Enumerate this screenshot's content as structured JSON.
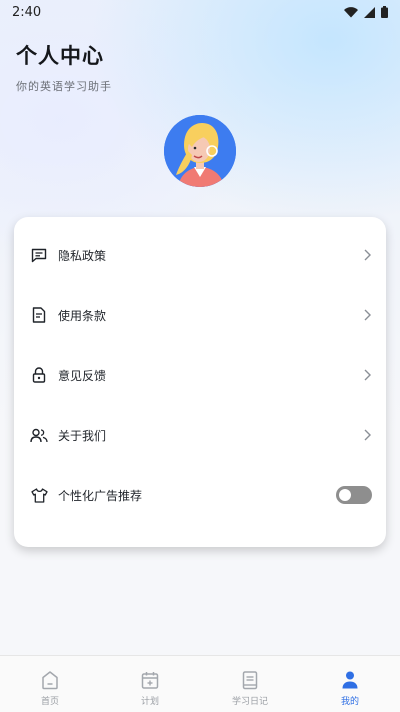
{
  "status_bar": {
    "time": "2:40"
  },
  "header": {
    "title": "个人中心",
    "subtitle": "你的英语学习助手"
  },
  "menu": {
    "items": [
      {
        "label": "隐私政策",
        "icon": "message-square-icon"
      },
      {
        "label": "使用条款",
        "icon": "document-icon"
      },
      {
        "label": "意见反馈",
        "icon": "lock-icon"
      },
      {
        "label": "关于我们",
        "icon": "users-icon"
      },
      {
        "label": "个性化广告推荐",
        "icon": "tshirt-icon",
        "toggle_on": false
      }
    ]
  },
  "tabs": [
    {
      "label": "首页",
      "icon": "home-icon",
      "active": false
    },
    {
      "label": "计划",
      "icon": "calendar-icon",
      "active": false
    },
    {
      "label": "学习日记",
      "icon": "book-icon",
      "active": false
    },
    {
      "label": "我的",
      "icon": "user-icon",
      "active": true
    }
  ],
  "colors": {
    "accent": "#2f6fe4",
    "inactive": "#9a9ea4",
    "toggle_off": "#8e8e8e"
  }
}
